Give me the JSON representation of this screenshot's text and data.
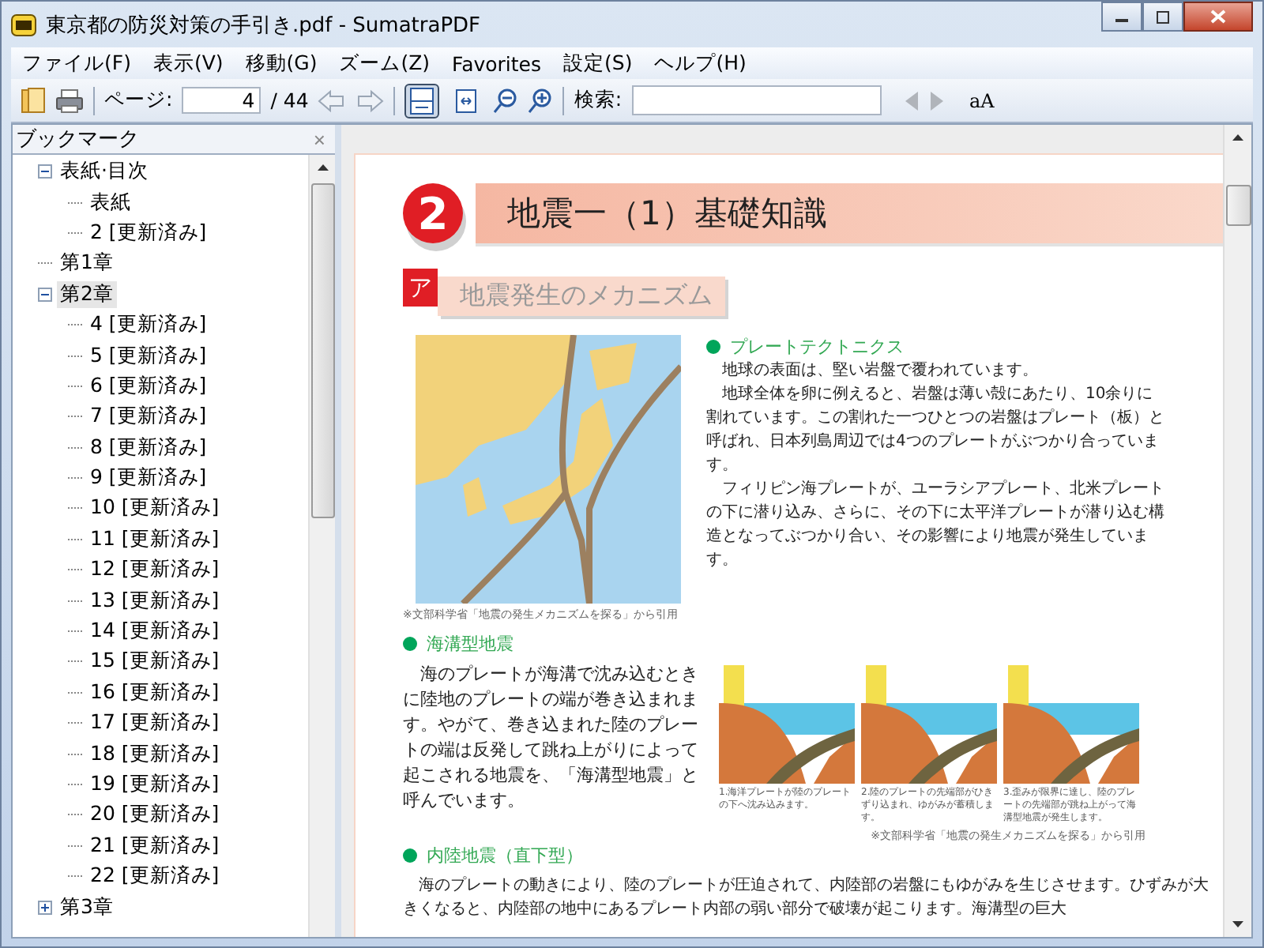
{
  "window": {
    "title": "東京都の防災対策の手引き.pdf - SumatraPDF"
  },
  "menu": [
    "ファイル(F)",
    "表示(V)",
    "移動(G)",
    "ズーム(Z)",
    "Favorites",
    "設定(S)",
    "ヘルプ(H)"
  ],
  "toolbar": {
    "page_label": "ページ:",
    "page_value": "4",
    "page_total": "/ 44",
    "search_label": "検索:",
    "case_button": "aA",
    "view_buttons": [
      {
        "kind": "fit-page",
        "selected": true
      },
      {
        "kind": "fit-width",
        "selected": false
      }
    ]
  },
  "sidebar": {
    "title": "ブックマーク",
    "close": "×",
    "items": [
      {
        "label": "表紙·目次",
        "expanded": true,
        "selected": false,
        "children": [
          {
            "label": "表紙",
            "selected": false
          },
          {
            "label": "2 [更新済み]",
            "selected": false
          }
        ]
      },
      {
        "label": "第1章",
        "selected": false
      },
      {
        "label": "第2章",
        "expanded": true,
        "selected": true,
        "children": [
          {
            "label": "4 [更新済み]",
            "selected": false
          },
          {
            "label": "5 [更新済み]",
            "selected": false
          },
          {
            "label": "6 [更新済み]",
            "selected": false
          },
          {
            "label": "7 [更新済み]",
            "selected": false
          },
          {
            "label": "8 [更新済み]",
            "selected": false
          },
          {
            "label": "9 [更新済み]",
            "selected": false
          },
          {
            "label": "10 [更新済み]",
            "selected": false
          },
          {
            "label": "11 [更新済み]",
            "selected": false
          },
          {
            "label": "12 [更新済み]",
            "selected": false
          },
          {
            "label": "13 [更新済み]",
            "selected": false
          },
          {
            "label": "14 [更新済み]",
            "selected": false
          },
          {
            "label": "15 [更新済み]",
            "selected": false
          },
          {
            "label": "16 [更新済み]",
            "selected": false
          },
          {
            "label": "17 [更新済み]",
            "selected": false
          },
          {
            "label": "18 [更新済み]",
            "selected": false
          },
          {
            "label": "19 [更新済み]",
            "selected": false
          },
          {
            "label": "20 [更新済み]",
            "selected": false
          },
          {
            "label": "21 [更新済み]",
            "selected": false
          },
          {
            "label": "22 [更新済み]",
            "selected": false
          }
        ]
      },
      {
        "label": "第3章",
        "expanded": false,
        "selected": false
      }
    ]
  },
  "document": {
    "heading_number": "2",
    "heading": "地震一（1）基礎知識",
    "section_mark": "ア",
    "section_title": "地震発生のメカニズム",
    "plates": {
      "title": "プレートテクトニクス",
      "paragraphs": [
        "　地球の表面は、堅い岩盤で覆われています。",
        "　地球全体を卵に例えると、岩盤は薄い殻にあたり、10余りに割れています。この割れた一つひとつの岩盤はプレート（板）と呼ばれ、日本列島周辺では4つのプレートがぶつかり合っています。",
        "　フィリピン海プレートが、ユーラシアプレート、北米プレートの下に潜り込み、さらに、その下に太平洋プレートが潜り込む構造となってぶつかり合い、その影響により地震が発生しています。"
      ],
      "map_source": "※文部科学省「地震の発生メカニズムを探る」から引用"
    },
    "trench": {
      "title": "海溝型地震",
      "paragraph": "　海のプレートが海溝で沈み込むときに陸地のプレートの端が巻き込まれます。やがて、巻き込まれた陸のプレートの端は反発して跳ね上がりによって起こされる地震を、「海溝型地震」と呼んでいます。",
      "captions": [
        "1.海洋プレートが陸のプレートの下へ沈み込みます。",
        "2.陸のプレートの先端部がひきずり込まれ、ゆがみが蓄積します。",
        "3.歪みが限界に達し、陸のプレートの先端部が跳ね上がって海溝型地震が発生します。"
      ],
      "source": "※文部科学省「地震の発生メカニズムを探る」から引用"
    },
    "inland": {
      "title": "内陸地震（直下型）",
      "paragraph": "　海のプレートの動きにより、陸のプレートが圧迫されて、内陸部の岩盤にもゆがみを生じさせます。ひずみが大きくなると、内陸部の地中にあるプレート内部の弱い部分で破壊が起こります。海溝型の巨大"
    }
  }
}
